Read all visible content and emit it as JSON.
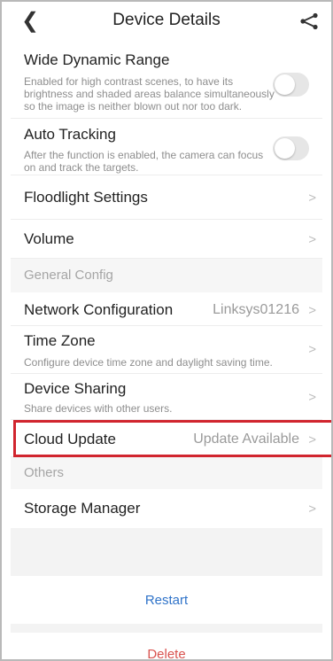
{
  "header": {
    "title": "Device Details",
    "back_icon": "chevron-left-icon",
    "share_icon": "share-icon"
  },
  "rows": {
    "wdr": {
      "label": "Wide Dynamic Range",
      "desc_lines": [
        "Enabled for high contrast scenes, to have its",
        "brightness and shaded areas balance simultaneously",
        "so the image is neither blown out nor too dark."
      ],
      "toggle_on": false
    },
    "auto_tracking": {
      "label": "Auto Tracking",
      "desc_lines": [
        "After the function is enabled, the camera can focus",
        "on and track the targets."
      ],
      "toggle_on": false
    },
    "floodlight": {
      "label": "Floodlight Settings"
    },
    "volume": {
      "label": "Volume"
    },
    "network": {
      "label": "Network Configuration",
      "value": "Linksys01216"
    },
    "time_zone": {
      "label": "Time Zone",
      "desc": "Configure device time zone and daylight saving time."
    },
    "device_sharing": {
      "label": "Device Sharing",
      "desc": "Share devices with other users."
    },
    "cloud_update": {
      "label": "Cloud Update",
      "value": "Update Available"
    },
    "storage": {
      "label": "Storage Manager"
    }
  },
  "sections": {
    "general": "General Config",
    "others": "Others"
  },
  "chevron": ">",
  "actions": {
    "restart": "Restart",
    "delete": "Delete"
  },
  "colors": {
    "restart": "#2f73c9",
    "delete": "#d9534f",
    "highlight": "#d1252e"
  }
}
